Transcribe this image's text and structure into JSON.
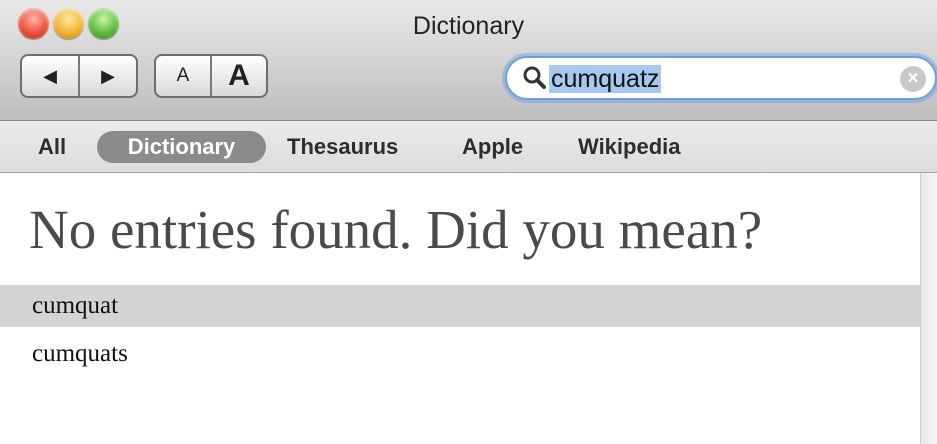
{
  "window": {
    "title": "Dictionary"
  },
  "toolbar": {
    "back_label": "◀",
    "forward_label": "▶",
    "font_smaller_label": "A",
    "font_larger_label": "A"
  },
  "search": {
    "value": "cumquatz",
    "clear_label": "×"
  },
  "scope_tabs": [
    {
      "label": "All"
    },
    {
      "label": "Dictionary",
      "selected": true
    },
    {
      "label": "Thesaurus"
    },
    {
      "label": "Apple"
    },
    {
      "label": "Wikipedia"
    }
  ],
  "results": {
    "heading": "No entries found. Did you mean?",
    "suggestions": [
      {
        "text": "cumquat",
        "selected": true
      },
      {
        "text": "cumquats"
      }
    ]
  },
  "colors": {
    "selected_tab": "#8b8b8b",
    "search_highlight": "#a7c8ef",
    "selected_row": "#d4d4d4"
  }
}
